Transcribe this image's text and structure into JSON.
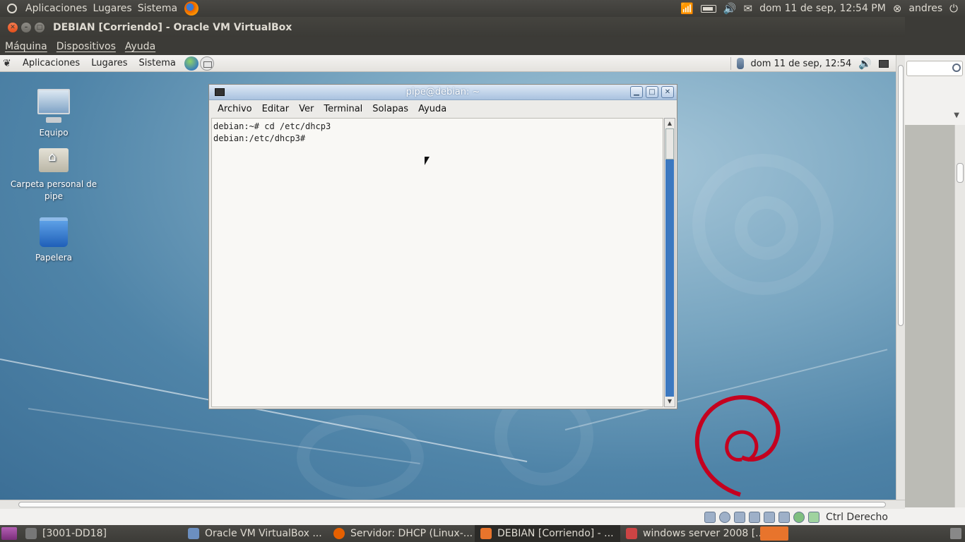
{
  "host_panel": {
    "menus": [
      "Aplicaciones",
      "Lugares",
      "Sistema"
    ],
    "datetime": "dom 11 de sep, 12:54 PM",
    "user": "andres"
  },
  "vbox": {
    "title": "DEBIAN [Corriendo] - Oracle VM VirtualBox",
    "menus": [
      "Máquina",
      "Dispositivos",
      "Ayuda"
    ],
    "host_key": "Ctrl Derecho"
  },
  "guest_panel": {
    "menus": [
      "Aplicaciones",
      "Lugares",
      "Sistema"
    ],
    "datetime": "dom 11 de sep, 12:54"
  },
  "desktop_icons": [
    {
      "label": "Equipo"
    },
    {
      "label": "Carpeta personal de pipe"
    },
    {
      "label": "Papelera"
    }
  ],
  "terminal": {
    "title": "pipe@debian: ~",
    "menus": [
      "Archivo",
      "Editar",
      "Ver",
      "Terminal",
      "Solapas",
      "Ayuda"
    ],
    "lines": [
      "debian:~# cd /etc/dhcp3",
      "debian:/etc/dhcp3#"
    ]
  },
  "taskbar": {
    "tasks": [
      {
        "label": "[3001-DD18]",
        "active": false
      },
      {
        "label": "Oracle VM VirtualBox ...",
        "active": false
      },
      {
        "label": "Servidor: DHCP (Linux-...",
        "active": false
      },
      {
        "label": "DEBIAN [Corriendo] - ...",
        "active": true
      },
      {
        "label": "windows server 2008 [...",
        "active": false
      }
    ]
  },
  "colors": {
    "terminal_scroll_track": "#3c78c0",
    "debian_red": "#c4001f"
  }
}
